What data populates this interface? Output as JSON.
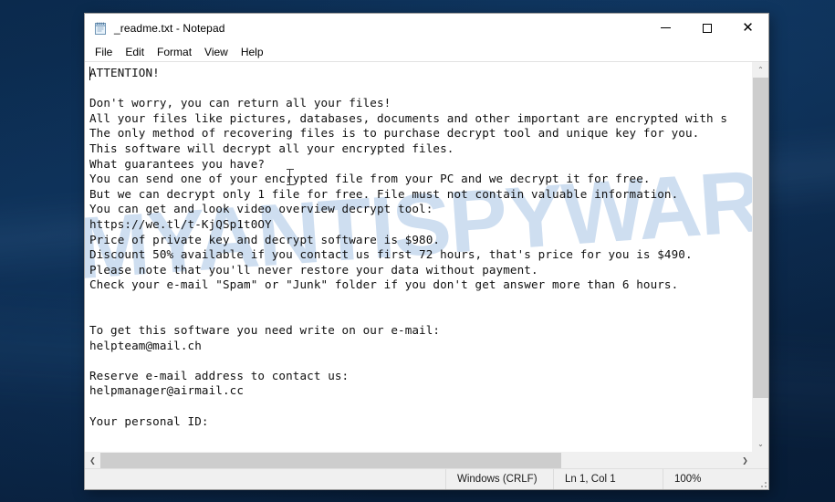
{
  "window": {
    "title": "_readme.txt - Notepad",
    "icon": "notepad-document-icon",
    "caption": {
      "minimize": "minimize-icon",
      "maximize": "maximize-icon",
      "close": "✕"
    }
  },
  "menubar": {
    "items": [
      {
        "label": "File"
      },
      {
        "label": "Edit"
      },
      {
        "label": "Format"
      },
      {
        "label": "View"
      },
      {
        "label": "Help"
      }
    ]
  },
  "document": {
    "filename": "_readme.txt",
    "text": "ATTENTION!\n\nDon't worry, you can return all your files!\nAll your files like pictures, databases, documents and other important are encrypted with s\nThe only method of recovering files is to purchase decrypt tool and unique key for you.\nThis software will decrypt all your encrypted files.\nWhat guarantees you have?\nYou can send one of your encrypted file from your PC and we decrypt it for free.\nBut we can decrypt only 1 file for free. File must not contain valuable information.\nYou can get and look video overview decrypt tool:\nhttps://we.tl/t-KjQSp1t0OY\nPrice of private key and decrypt software is $980.\nDiscount 50% available if you contact us first 72 hours, that's price for you is $490.\nPlease note that you'll never restore your data without payment.\nCheck your e-mail \"Spam\" or \"Junk\" folder if you don't get answer more than 6 hours.\n\n\nTo get this software you need write on our e-mail:\nhelpteam@mail.ch\n\nReserve e-mail address to contact us:\nhelpmanager@airmail.cc\n\nYour personal ID:",
    "video_url": "https://we.tl/t-KjQSp1t0OY",
    "price": "$980",
    "discount_price": "$490",
    "discount_percent": "50%",
    "discount_window_hours": "72",
    "answer_within_hours": "6",
    "primary_email": "helpteam@mail.ch",
    "reserve_email": "helpmanager@airmail.cc"
  },
  "watermark": {
    "text": "MYANTISPYWARE.COM",
    "color": "#bed3ec"
  },
  "scrollbars": {
    "vertical": {
      "up_arrow": "⌃",
      "down_arrow": "⌄"
    },
    "horizontal": {
      "left_arrow": "❮",
      "right_arrow": "❯"
    }
  },
  "statusbar": {
    "line_ending": "Windows (CRLF)",
    "cursor_position": "Ln 1, Col 1",
    "zoom": "100%"
  },
  "colors": {
    "desktop": "#0a2342",
    "window_bg": "#ffffff",
    "chrome": "#f0f0f0",
    "scroll_thumb": "#cdcdcd",
    "text": "#101010"
  }
}
